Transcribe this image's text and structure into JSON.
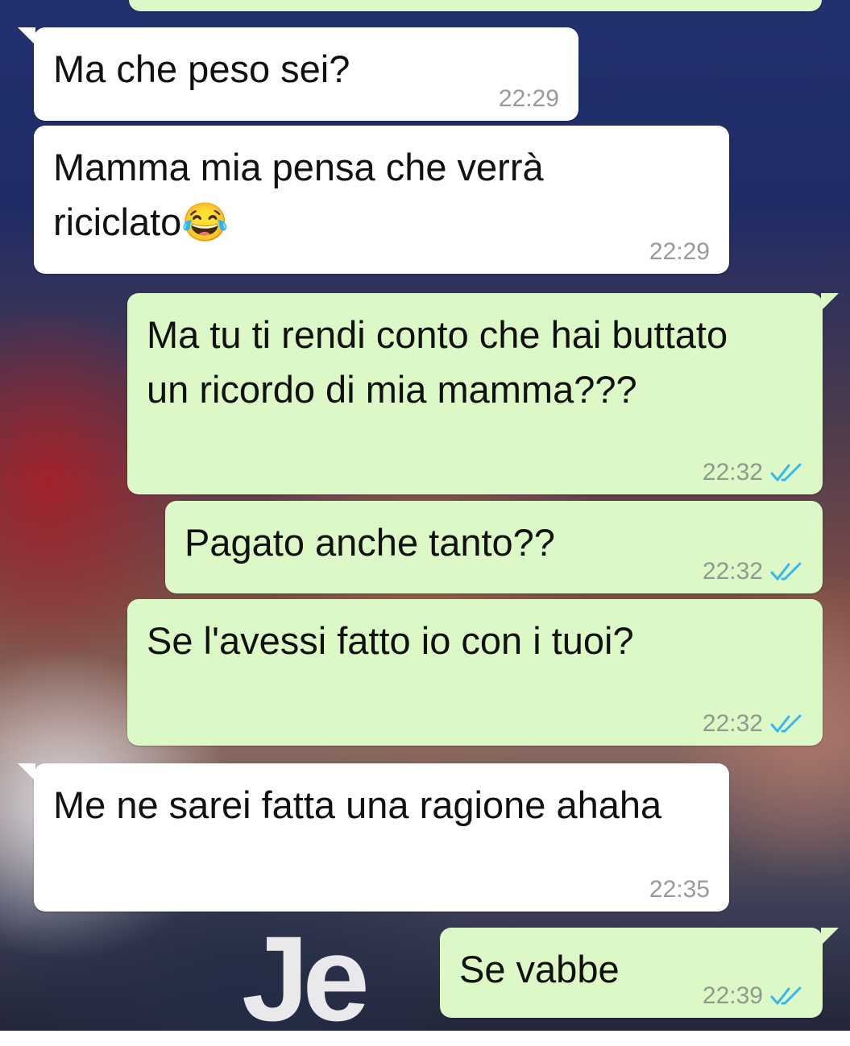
{
  "chat": {
    "colors": {
      "incoming_bubble": "#ffffff",
      "outgoing_bubble": "#dcf8c6",
      "read_ticks": "#34b7f1"
    },
    "messages": [
      {
        "direction": "incoming",
        "text": "Ma che peso sei?",
        "time": "22:29"
      },
      {
        "direction": "incoming",
        "text": "Mamma mia pensa che verrà riciclato😂",
        "time": "22:29"
      },
      {
        "direction": "outgoing",
        "text": "Ma tu ti rendi conto che hai buttato un ricordo di mia mamma???",
        "time": "22:32",
        "status": "read-ticks-icon"
      },
      {
        "direction": "outgoing",
        "text": "Pagato anche tanto??",
        "time": "22:32",
        "status": "read-ticks-icon"
      },
      {
        "direction": "outgoing",
        "text": "Se l'avessi fatto io con i tuoi?",
        "time": "22:32",
        "status": "read-ticks-icon"
      },
      {
        "direction": "incoming",
        "text": "Me ne sarei fatta una ragione ahaha",
        "time": "22:35"
      },
      {
        "direction": "outgoing",
        "text": "Se vabbe",
        "time": "22:39",
        "status": "read-ticks-icon"
      }
    ]
  },
  "wallpaper": {
    "jersey_text": "Je"
  }
}
